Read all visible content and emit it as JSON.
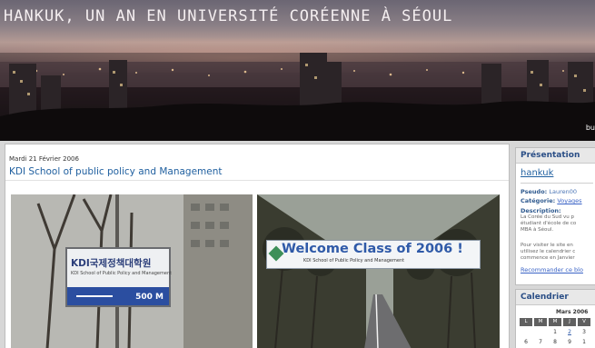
{
  "header": {
    "title": "HANKUK, UN AN EN UNIVERSITÉ CORÉENNE À SÉOUL",
    "corner_text": "bu"
  },
  "post": {
    "date": "Mardi 21 Février 2006",
    "title": "KDI School of public policy and Management",
    "photo_left": {
      "sign_line1": "KDI국제정책대학원",
      "sign_line2": "KDI School of Public Policy and Management",
      "sign_distance": "500 M"
    },
    "photo_right": {
      "banner_text": "Welcome Class of 2006 !",
      "banner_sub": "KDI School of Public Policy and Management"
    }
  },
  "sidebar": {
    "presentation": {
      "title": "Présentation",
      "username": "hankuk",
      "pseudo_label": "Pseudo:",
      "pseudo_value": "Lauren00",
      "category_label": "Catégorie:",
      "category_value": "Voyages",
      "description_label": "Description:",
      "description_lines": [
        "La Corée du Sud vu p",
        "étudiant d'école de co",
        "MBA à Séoul."
      ],
      "note_lines": [
        "Pour visiter le site en",
        "utilisez le calendrier c",
        "commence en Janvier"
      ],
      "recommend_link": "Recommander ce blo"
    },
    "calendar": {
      "title": "Calendrier",
      "month": "Mars 2006",
      "day_headers": [
        "L",
        "M",
        "M",
        "J",
        "V"
      ],
      "rows": [
        [
          "",
          "",
          "1",
          "2",
          "3"
        ],
        [
          "6",
          "7",
          "8",
          "9",
          "1"
        ]
      ]
    }
  }
}
